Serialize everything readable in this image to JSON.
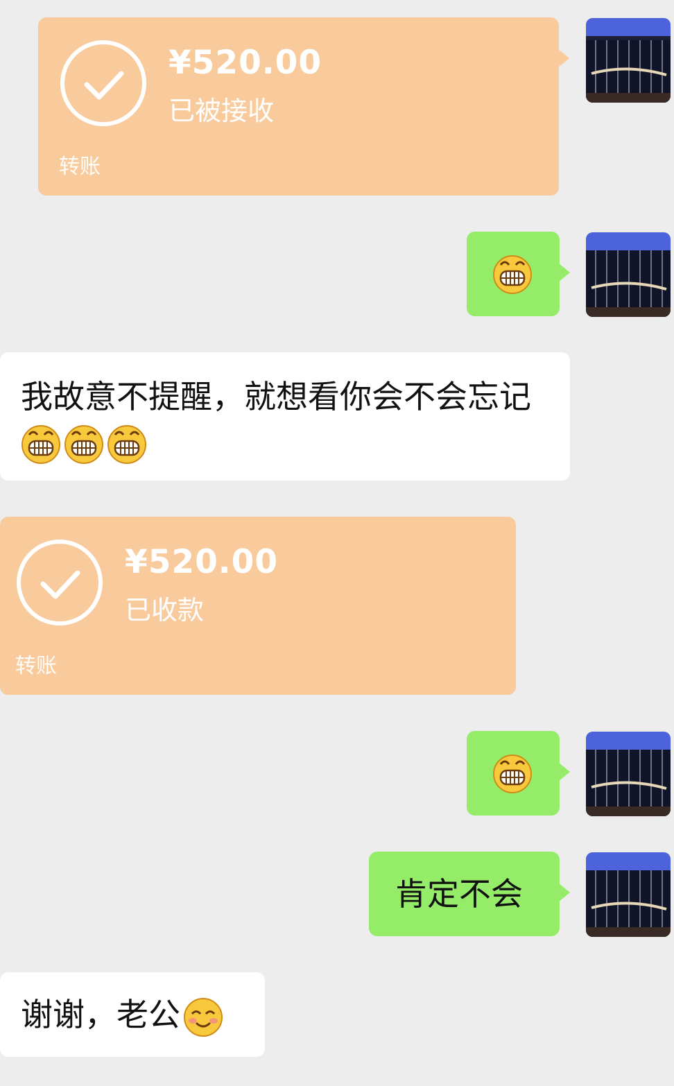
{
  "chat": {
    "transfer_1": {
      "amount": "¥520.00",
      "status": "已被接收",
      "label": "转账"
    },
    "transfer_2": {
      "amount": "¥520.00",
      "status": "已收款",
      "label": "转账"
    },
    "msg_tease": {
      "text": "我故意不提醒，就想看你会不会忘记",
      "emojis": [
        "grin-emoji",
        "grin-emoji",
        "grin-emoji"
      ]
    },
    "msg_sure": {
      "text": "肯定不会"
    },
    "msg_thanks": {
      "text": "谢谢，老公",
      "emoji": "blush-emoji"
    },
    "self_emoji_messages": [
      "grin-emoji",
      "grin-emoji"
    ]
  },
  "colors": {
    "background": "#ededed",
    "transfer_card": "#f9cb9c",
    "self_bubble": "#95ec69",
    "other_bubble": "#ffffff"
  }
}
